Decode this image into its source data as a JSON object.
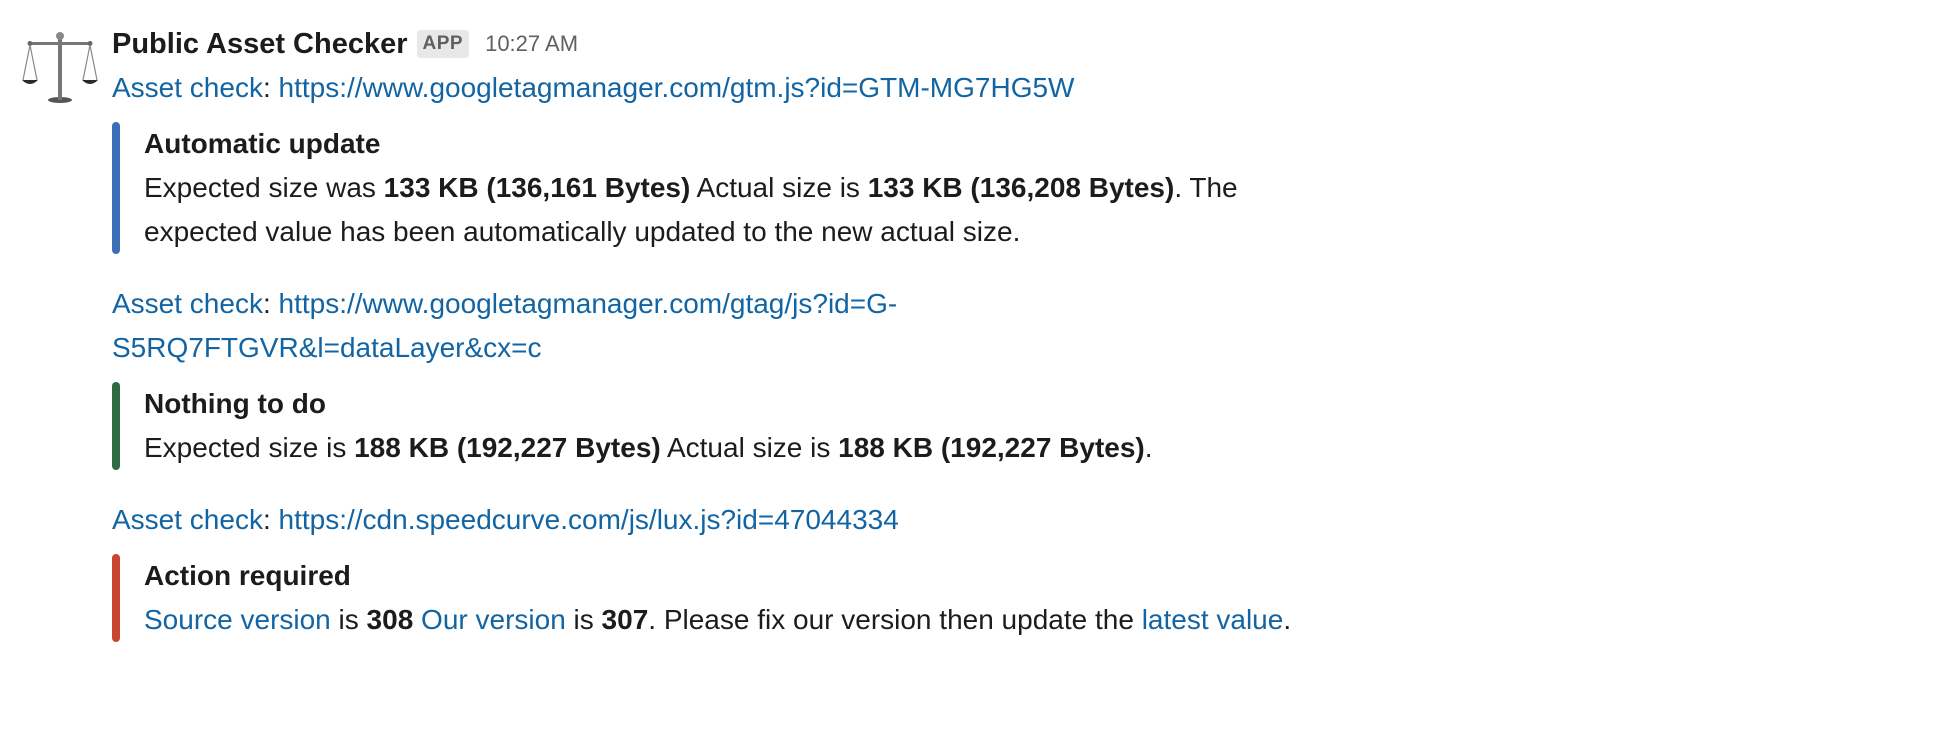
{
  "message": {
    "sender": "Public Asset Checker",
    "badge": "APP",
    "time": "10:27 AM",
    "avatar_icon": "scales-of-justice-icon"
  },
  "checks": [
    {
      "label": "Asset check",
      "url": "https://www.googletagmanager.com/gtm.js?id=GTM-MG7HG5W",
      "title": "Automatic update",
      "color": "#3d6fb8",
      "body": {
        "p1": "Expected size was ",
        "v1": "133 KB (136,161 Bytes)",
        "p2": " Actual size is ",
        "v2": "133 KB (136,208 Bytes)",
        "p3": ". The expected value has been automatically updated to the new actual size."
      }
    },
    {
      "label": "Asset check",
      "url": "https://www.googletagmanager.com/gtag/js?id=G-S5RQ7FTGVR&l=dataLayer&cx=c",
      "title": "Nothing to do",
      "color": "#2e6a42",
      "body": {
        "p1": "Expected size is ",
        "v1": "188 KB (192,227 Bytes)",
        "p2": " Actual size is ",
        "v2": "188 KB (192,227 Bytes)",
        "p3": "."
      }
    },
    {
      "label": "Asset check",
      "url": "https://cdn.speedcurve.com/js/lux.js?id=47044334",
      "title": "Action required",
      "color": "#c8462d",
      "body": {
        "link1": "Source version",
        "t1": " is ",
        "v1": "308",
        "sp": " ",
        "link2": "Our version",
        "t2": " is ",
        "v2": "307",
        "t3": ". Please fix our version then update the ",
        "link3": "latest value",
        "t4": "."
      }
    }
  ]
}
